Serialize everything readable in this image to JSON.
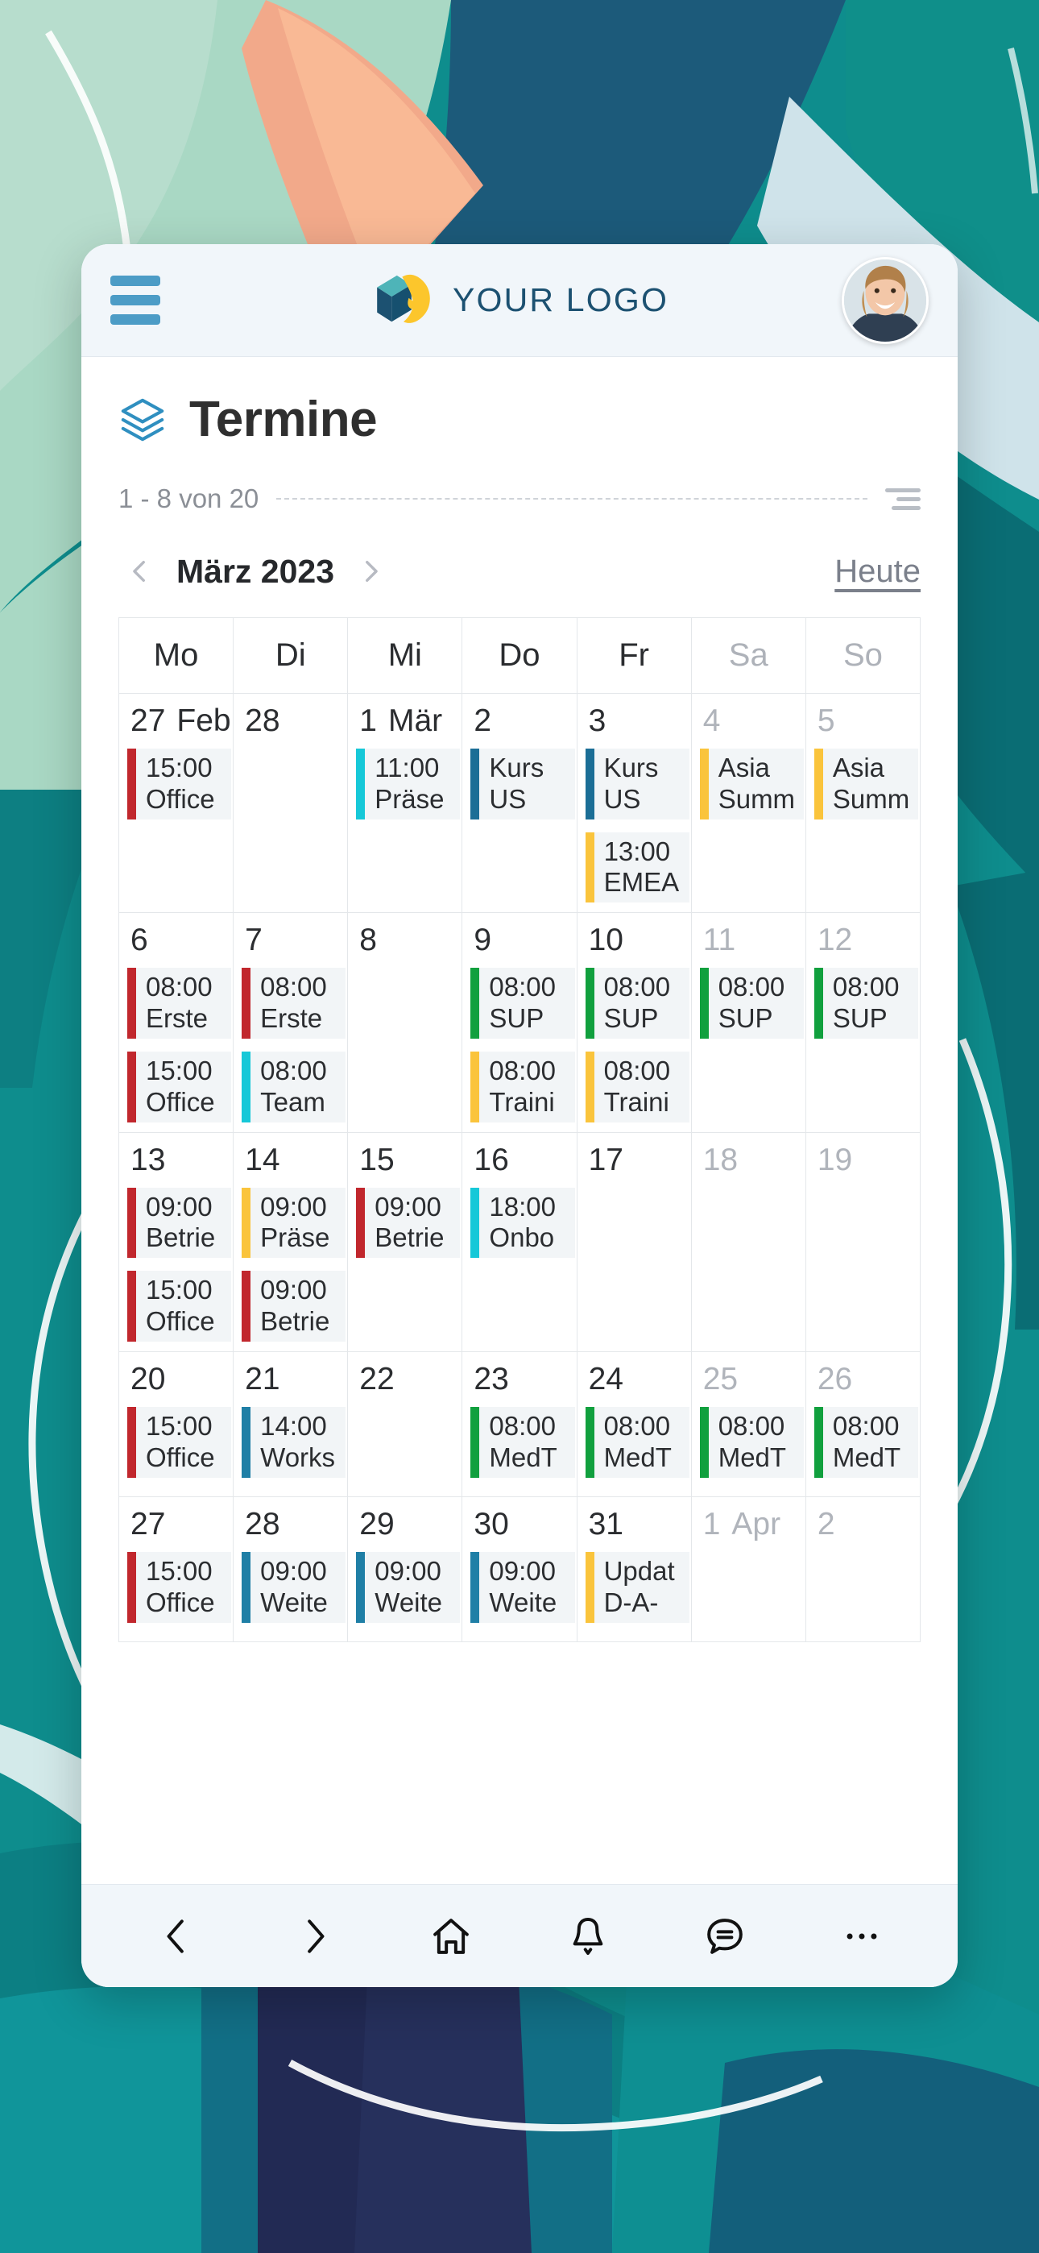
{
  "header": {
    "menu_icon": "hamburger-icon",
    "brand": "YOUR LOGO",
    "avatar_icon": "user-avatar"
  },
  "page": {
    "title": "Termine",
    "title_icon": "layers-icon"
  },
  "toolbar": {
    "count_text": "1 - 8 von 20",
    "filter_icon": "filter-icon"
  },
  "calendar_nav": {
    "prev_icon": "chevron-left-icon",
    "next_icon": "chevron-right-icon",
    "month_label": "März 2023",
    "today_label": "Heute"
  },
  "calendar": {
    "weekdays": [
      {
        "label": "Mo",
        "weekend": false
      },
      {
        "label": "Di",
        "weekend": false
      },
      {
        "label": "Mi",
        "weekend": false
      },
      {
        "label": "Do",
        "weekend": false
      },
      {
        "label": "Fr",
        "weekend": false
      },
      {
        "label": "Sa",
        "weekend": true
      },
      {
        "label": "So",
        "weekend": true
      }
    ],
    "colors": {
      "red": "#c1272d",
      "cyan": "#16c8d8",
      "blue": "#1b6e96",
      "yellow": "#fac43c",
      "green": "#11a03e",
      "steel": "#1f7fa6"
    },
    "weeks": [
      [
        {
          "day": "27",
          "month": "Feb",
          "muted": false,
          "events": [
            {
              "color": "red",
              "line1": "15:00",
              "line2": "Office"
            }
          ]
        },
        {
          "day": "28",
          "month": "",
          "muted": false,
          "events": []
        },
        {
          "day": "1",
          "month": "Mär",
          "muted": false,
          "events": [
            {
              "color": "cyan",
              "line1": "11:00",
              "line2": "Präse"
            }
          ]
        },
        {
          "day": "2",
          "month": "",
          "muted": false,
          "events": [
            {
              "color": "blue",
              "line1": "Kurs",
              "line2": "US"
            }
          ]
        },
        {
          "day": "3",
          "month": "",
          "muted": false,
          "events": [
            {
              "color": "blue",
              "line1": "Kurs",
              "line2": "US"
            },
            {
              "color": "yellow",
              "line1": "13:00",
              "line2": "EMEA"
            }
          ]
        },
        {
          "day": "4",
          "month": "",
          "muted": true,
          "events": [
            {
              "color": "yellow",
              "line1": "Asia",
              "line2": "Summ"
            }
          ]
        },
        {
          "day": "5",
          "month": "",
          "muted": true,
          "events": [
            {
              "color": "yellow",
              "line1": "Asia",
              "line2": "Summ"
            }
          ]
        }
      ],
      [
        {
          "day": "6",
          "month": "",
          "muted": false,
          "events": [
            {
              "color": "red",
              "line1": "08:00",
              "line2": "Erste"
            },
            {
              "color": "red",
              "line1": "15:00",
              "line2": "Office"
            }
          ]
        },
        {
          "day": "7",
          "month": "",
          "muted": false,
          "events": [
            {
              "color": "red",
              "line1": "08:00",
              "line2": "Erste"
            },
            {
              "color": "cyan",
              "line1": "08:00",
              "line2": "Team"
            }
          ]
        },
        {
          "day": "8",
          "month": "",
          "muted": false,
          "events": []
        },
        {
          "day": "9",
          "month": "",
          "muted": false,
          "events": [
            {
              "color": "green",
              "line1": "08:00",
              "line2": "SUP"
            },
            {
              "color": "yellow",
              "line1": "08:00",
              "line2": "Traini"
            }
          ]
        },
        {
          "day": "10",
          "month": "",
          "muted": false,
          "events": [
            {
              "color": "green",
              "line1": "08:00",
              "line2": "SUP"
            },
            {
              "color": "yellow",
              "line1": "08:00",
              "line2": "Traini"
            }
          ]
        },
        {
          "day": "11",
          "month": "",
          "muted": true,
          "events": [
            {
              "color": "green",
              "line1": "08:00",
              "line2": "SUP"
            }
          ]
        },
        {
          "day": "12",
          "month": "",
          "muted": true,
          "events": [
            {
              "color": "green",
              "line1": "08:00",
              "line2": "SUP"
            }
          ]
        }
      ],
      [
        {
          "day": "13",
          "month": "",
          "muted": false,
          "events": [
            {
              "color": "red",
              "line1": "09:00",
              "line2": "Betrie"
            },
            {
              "color": "red",
              "line1": "15:00",
              "line2": "Office"
            }
          ]
        },
        {
          "day": "14",
          "month": "",
          "muted": false,
          "events": [
            {
              "color": "yellow",
              "line1": "09:00",
              "line2": "Präse"
            },
            {
              "color": "red",
              "line1": "09:00",
              "line2": "Betrie"
            }
          ]
        },
        {
          "day": "15",
          "month": "",
          "muted": false,
          "events": [
            {
              "color": "red",
              "line1": "09:00",
              "line2": "Betrie"
            }
          ]
        },
        {
          "day": "16",
          "month": "",
          "muted": false,
          "events": [
            {
              "color": "cyan",
              "line1": "18:00",
              "line2": "Onbo"
            }
          ]
        },
        {
          "day": "17",
          "month": "",
          "muted": false,
          "events": []
        },
        {
          "day": "18",
          "month": "",
          "muted": true,
          "events": []
        },
        {
          "day": "19",
          "month": "",
          "muted": true,
          "events": []
        }
      ],
      [
        {
          "day": "20",
          "month": "",
          "muted": false,
          "events": [
            {
              "color": "red",
              "line1": "15:00",
              "line2": "Office"
            }
          ]
        },
        {
          "day": "21",
          "month": "",
          "muted": false,
          "events": [
            {
              "color": "steel",
              "line1": "14:00",
              "line2": "Works"
            }
          ]
        },
        {
          "day": "22",
          "month": "",
          "muted": false,
          "events": []
        },
        {
          "day": "23",
          "month": "",
          "muted": false,
          "events": [
            {
              "color": "green",
              "line1": "08:00",
              "line2": "MedT"
            }
          ]
        },
        {
          "day": "24",
          "month": "",
          "muted": false,
          "events": [
            {
              "color": "green",
              "line1": "08:00",
              "line2": "MedT"
            }
          ]
        },
        {
          "day": "25",
          "month": "",
          "muted": true,
          "events": [
            {
              "color": "green",
              "line1": "08:00",
              "line2": "MedT"
            }
          ]
        },
        {
          "day": "26",
          "month": "",
          "muted": true,
          "events": [
            {
              "color": "green",
              "line1": "08:00",
              "line2": "MedT"
            }
          ]
        }
      ],
      [
        {
          "day": "27",
          "month": "",
          "muted": false,
          "events": [
            {
              "color": "red",
              "line1": "15:00",
              "line2": "Office"
            }
          ]
        },
        {
          "day": "28",
          "month": "",
          "muted": false,
          "events": [
            {
              "color": "steel",
              "line1": "09:00",
              "line2": "Weite"
            }
          ]
        },
        {
          "day": "29",
          "month": "",
          "muted": false,
          "events": [
            {
              "color": "steel",
              "line1": "09:00",
              "line2": "Weite"
            }
          ]
        },
        {
          "day": "30",
          "month": "",
          "muted": false,
          "events": [
            {
              "color": "steel",
              "line1": "09:00",
              "line2": "Weite"
            }
          ]
        },
        {
          "day": "31",
          "month": "",
          "muted": false,
          "events": [
            {
              "color": "yellow",
              "line1": "Updat",
              "line2": "D-A-"
            }
          ]
        },
        {
          "day": "1",
          "month": "Apr",
          "muted": true,
          "events": []
        },
        {
          "day": "2",
          "month": "",
          "muted": true,
          "events": []
        }
      ]
    ]
  },
  "bottom_nav": [
    {
      "icon": "chevron-left-icon",
      "name": "nav-back"
    },
    {
      "icon": "chevron-right-icon",
      "name": "nav-forward"
    },
    {
      "icon": "home-icon",
      "name": "nav-home"
    },
    {
      "icon": "bell-icon",
      "name": "nav-notifications"
    },
    {
      "icon": "chat-icon",
      "name": "nav-messages"
    },
    {
      "icon": "ellipsis-icon",
      "name": "nav-more"
    }
  ]
}
